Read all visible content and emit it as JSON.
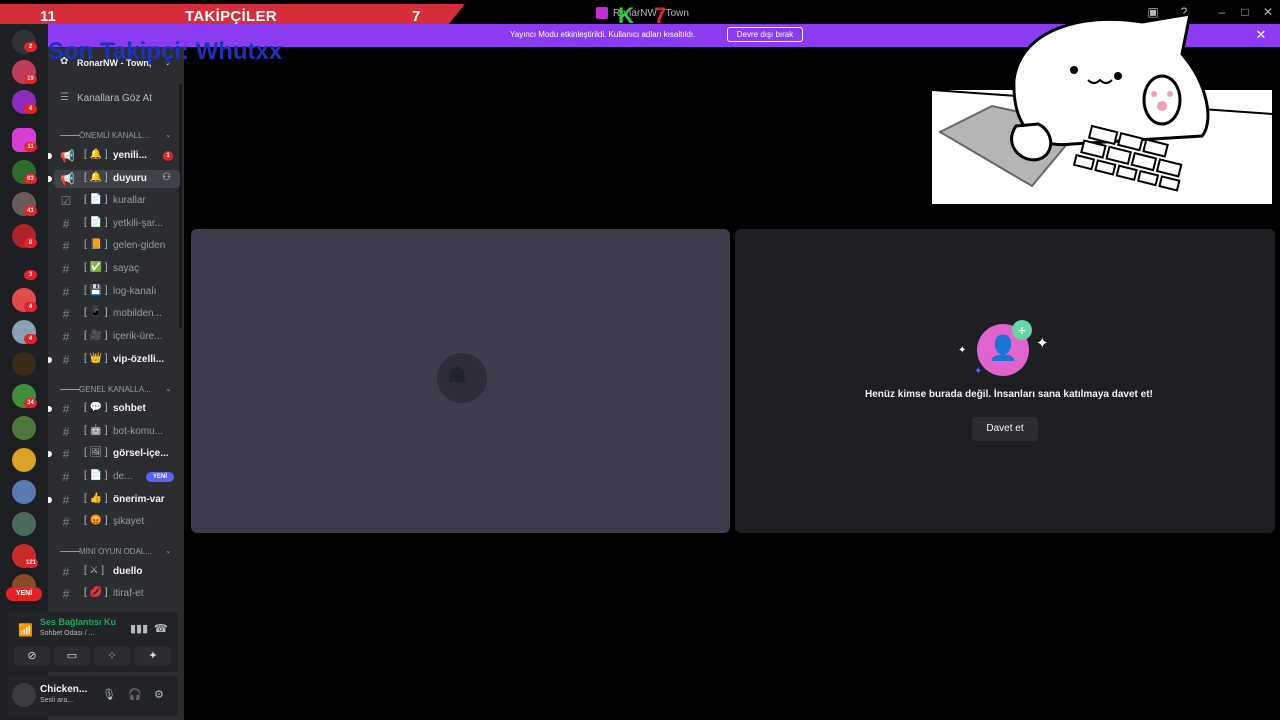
{
  "titlebar": {
    "follow_left": "11",
    "follow_label": "TAKİPÇİLER",
    "follow_right": "7",
    "app_title": "RonarNW - Town",
    "overlay_k": "K",
    "overlay_7": "7"
  },
  "notice": {
    "text": "Yayıncı Modu etkinleştirildi. Kullanıcı adları kısaltıldı.",
    "button": "Devre dışı bırak",
    "last_follower": "Son Takipçi: Whutxx"
  },
  "rail": {
    "badges": [
      "2",
      "19",
      "4",
      "11",
      "83",
      "41",
      "8",
      "3",
      "4",
      "4",
      "34",
      "121"
    ],
    "new_label": "YENİ"
  },
  "server": {
    "name": "RonarNW - Town,",
    "browse": "Kanallara Göz At"
  },
  "categories": {
    "important": "ÖNEMLİ KANALL...",
    "general": "GENEL KANALLA...",
    "minigame": "MİNİ OYUN ODAL..."
  },
  "channels": [
    {
      "emoji": "[ 🔔 ]",
      "name": "yenili...",
      "mention": "1"
    },
    {
      "emoji": "[ 🔔 ]",
      "name": "duyuru"
    },
    {
      "emoji": "[ 📄 ]",
      "name": "kurallar"
    },
    {
      "emoji": "[ 📄 ]",
      "name": "yetkili-şar..."
    },
    {
      "emoji": "[ 📙 ]",
      "name": "gelen-giden"
    },
    {
      "emoji": "[ ✅ ]",
      "name": "sayaç"
    },
    {
      "emoji": "[ 💾 ]",
      "name": "log-kanalı"
    },
    {
      "emoji": "[ 📱 ]",
      "name": "mobilden..."
    },
    {
      "emoji": "[ 🎥 ]",
      "name": "içerik-üre..."
    },
    {
      "emoji": "[ 👑 ]",
      "name": "vip-özelli..."
    },
    {
      "emoji": "[ 💬 ]",
      "name": "sohbet"
    },
    {
      "emoji": "[ 🤖 ]",
      "name": "bot-komu..."
    },
    {
      "emoji": "[ 🖼 ]",
      "name": "görsel-içe..."
    },
    {
      "emoji": "[ 📄 ]",
      "name": "de...",
      "badge": "YENİ"
    },
    {
      "emoji": "[ 👍 ]",
      "name": "önerim-var"
    },
    {
      "emoji": "[ 😡 ]",
      "name": "şikayet"
    },
    {
      "emoji": "[ ⚔ ]",
      "name": "duello"
    },
    {
      "emoji": "[ 💋 ]",
      "name": "itiraf-et"
    }
  ],
  "voice": {
    "status": "Ses Bağlantısı Ku",
    "channel": "Sohbet Odası / ..."
  },
  "user": {
    "name": "Chicken...",
    "sub": "Sesli ara..."
  },
  "stage": {
    "empty_text": "Henüz kimse burada değil. İnsanları sana katılmaya davet et!",
    "invite_button": "Davet et"
  },
  "colors": {
    "notice": "#8b3cf0",
    "banner": "#d62d3a",
    "online": "#23a55a",
    "tile_you": "#3d3b4c"
  }
}
